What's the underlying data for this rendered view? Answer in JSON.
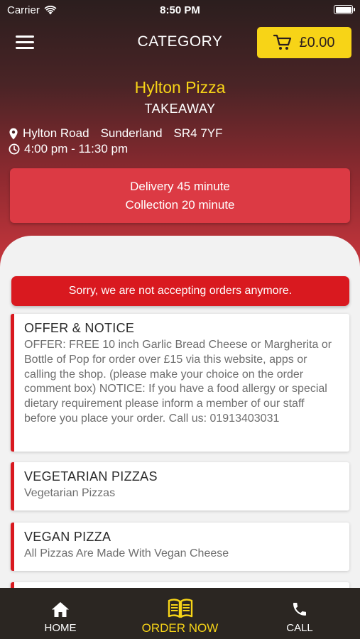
{
  "status_bar": {
    "carrier": "Carrier",
    "time": "8:50 PM"
  },
  "header": {
    "title": "CATEGORY",
    "cart_total": "£0.00"
  },
  "shop": {
    "name": "Hylton Pizza",
    "type": "TAKEAWAY",
    "address_street": "Hylton Road",
    "address_city": "Sunderland",
    "address_postcode": "SR4 7YF",
    "hours": "4:00 pm - 11:30 pm"
  },
  "delivery": {
    "delivery_time": "Delivery 45 minute",
    "collection_time": "Collection 20 minute"
  },
  "notice": "Sorry, we are not accepting orders anymore.",
  "categories": [
    {
      "title": "OFFER & NOTICE",
      "description": "OFFER: FREE 10 inch Garlic Bread Cheese or Margherita or Bottle of Pop for order over £15 via this website, apps or calling the shop. (please make your choice on the order comment box)  NOTICE: If you have a food allergy or special dietary requirement please inform a member of our staff before you place your order.  Call us: 01913403031"
    },
    {
      "title": "VEGETARIAN PIZZAS",
      "description": "Vegetarian Pizzas"
    },
    {
      "title": "VEGAN PIZZA",
      "description": "All Pizzas Are Made With Vegan Cheese"
    }
  ],
  "bottom_nav": {
    "home": "HOME",
    "order_now": "ORDER NOW",
    "call": "CALL"
  },
  "colors": {
    "accent_yellow": "#f7d417",
    "accent_red": "#d9191f",
    "dark": "#2b2622"
  }
}
